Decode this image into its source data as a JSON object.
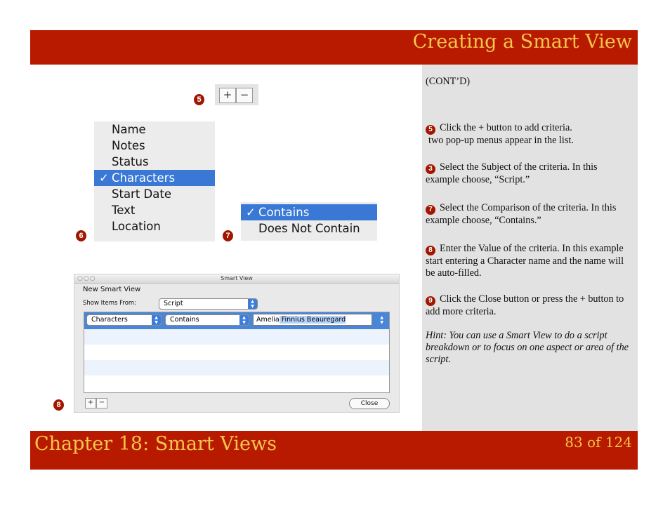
{
  "header": {
    "title": "Creating a Smart View"
  },
  "footer": {
    "chapter": "Chapter 18: Smart Views",
    "page": "83 of 124"
  },
  "badges": {
    "b5": "5",
    "b6": "6",
    "b7": "7",
    "b8": "8"
  },
  "plusminus": {
    "plus": "+",
    "minus": "−"
  },
  "subject_menu": {
    "items": [
      "Name",
      "Notes",
      "Status",
      "Characters",
      "Start Date",
      "Text",
      "Location"
    ],
    "selected": "Characters",
    "check": "✓"
  },
  "comparison_menu": {
    "items": [
      "Contains",
      "Does Not Contain"
    ],
    "selected": "Contains",
    "check": "✓"
  },
  "dialog": {
    "window_title": "Smart View",
    "traffic_lights": "○○○",
    "heading": "New Smart View",
    "show_items_label": "Show Items From:",
    "show_items_value": "Script",
    "criteria_subject": "Characters",
    "criteria_comparison": "Contains",
    "value_typed": "Amelia",
    "value_autofill": " Finnius Beauregard",
    "plus": "+",
    "minus": "−",
    "close_label": "Close"
  },
  "sidebar": {
    "contd": "(CONT’D)",
    "step5": "Click the + button to add criteria.",
    "step5b": "two pop-up menus appear in the list.",
    "step3": "Select the Subject of the criteria. In this example choose, “Script.”",
    "step7": "Select the Comparison of the criteria. In this example choose, “Contains.”",
    "step8": "Enter the Value of the criteria. In this example start entering a Character name and the name will be auto-filled.",
    "step9": "Click the Close button or press the + button to add more criteria.",
    "hint": "Hint: You can use a Smart View to do a script breakdown or to focus on one aspect or area of the script.",
    "n5": "5",
    "n3": "3",
    "n7": "7",
    "n8": "8",
    "n9": "9"
  }
}
